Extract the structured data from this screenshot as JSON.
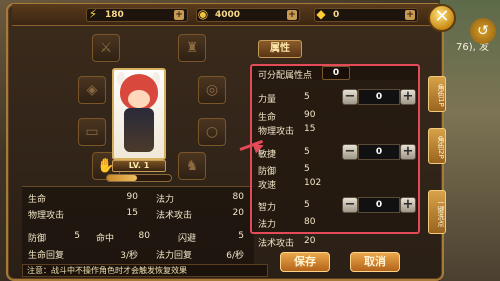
{
  "resources": {
    "energy": "180",
    "gold": "4000",
    "ingot": "0"
  },
  "background_text": "76), 发",
  "portrait": {
    "level": "LV. 1"
  },
  "stats": {
    "hp_label": "生命",
    "hp_value": "90",
    "mana_label": "法力",
    "mana_value": "80",
    "patk_label": "物理攻击",
    "patk_value": "15",
    "matk_label": "法术攻击",
    "matk_value": "20",
    "def_label": "防御",
    "def_value": "5",
    "hit_label": "命中",
    "hit_value": "80",
    "dodge_label": "闪避",
    "dodge_value": "5",
    "hpregen_label": "生命回复",
    "hpregen_value": "3/秒",
    "mpregen_label": "法力回复",
    "mpregen_value": "6/秒"
  },
  "notice": "注意：战斗中不操作角色时才会触发恢复效果",
  "attribute_tab": "属性",
  "allocation": {
    "points_label": "可分配属性点",
    "points_value": "0",
    "strength": {
      "label": "力量",
      "base": "5",
      "value": "0",
      "derived1_label": "生命",
      "derived1_value": "90",
      "derived2_label": "物理攻击",
      "derived2_value": "15"
    },
    "agility": {
      "label": "敏捷",
      "base": "5",
      "value": "0",
      "derived1_label": "防御",
      "derived1_value": "5",
      "derived2_label": "攻速",
      "derived2_value": "102"
    },
    "intellect": {
      "label": "智力",
      "base": "5",
      "value": "0",
      "derived1_label": "法力",
      "derived1_value": "80",
      "derived2_label": "法术攻击",
      "derived2_value": "20"
    }
  },
  "side_tabs": [
    "角色1P",
    "角色2P",
    "一键洗点"
  ],
  "buttons": {
    "save": "保存",
    "cancel": "取消"
  },
  "step": {
    "minus": "−",
    "plus": "+"
  }
}
